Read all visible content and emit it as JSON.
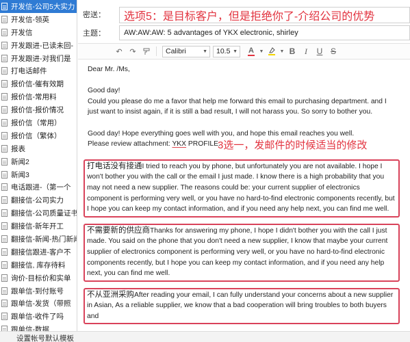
{
  "sidebar": {
    "items": [
      {
        "label": "开发信-公司5大实力",
        "selected": true
      },
      {
        "label": "开发信-领英"
      },
      {
        "label": "开发信"
      },
      {
        "label": "开发跟进-已读未回-"
      },
      {
        "label": "开发跟进-对我们是"
      },
      {
        "label": "打电话邮件"
      },
      {
        "label": "报价信-催有效期"
      },
      {
        "label": "报价信-常用料"
      },
      {
        "label": "报价信-报价情况"
      },
      {
        "label": "报价信（常用）"
      },
      {
        "label": "报价信（繁体）"
      },
      {
        "label": "报表"
      },
      {
        "label": "新闻2"
      },
      {
        "label": "新闻3"
      },
      {
        "label": "电话跟进-（第一个"
      },
      {
        "label": "翻接信-公司实力"
      },
      {
        "label": "翻接信-公司质量证书"
      },
      {
        "label": "翻接信-新年开工"
      },
      {
        "label": "翻接信-新闻-热门新闻"
      },
      {
        "label": "翻接信跟进-客户不"
      },
      {
        "label": "翻接信, 库存待料"
      },
      {
        "label": "询价-目标价和实单"
      },
      {
        "label": "跟单信-到付账号"
      },
      {
        "label": "跟单信-发货（带照"
      },
      {
        "label": "跟单信-收件了吗"
      },
      {
        "label": "跟单信-数据"
      }
    ]
  },
  "header": {
    "cc_label": "密送：",
    "cc_value": "选项5：是目标客户，但是拒绝你了-介绍公司的优势",
    "subject_label": "主题：",
    "subject_value": "AW:AW:AW: 5 advantages of YKX electronic, shirley"
  },
  "toolbar": {
    "font_family": "Calibri",
    "font_size": "10.5",
    "font_color": "#e2333f",
    "highlight_color": "#f3d400"
  },
  "email": {
    "greeting": "Dear  Mr. /Ms,",
    "good_day": "Good day!",
    "para1": "Could you please do me a favor that help me forward this email to purchasing department. and I just want to insist again, if it is still a bad result, I will not harass you. So sorry to bother you.",
    "para2_line1": "Good day! Hope everything goes well with you, and hope this email reaches you well.",
    "para2_line2_prefix": "Please review attachment: ",
    "para2_line2_link": "YKX",
    "para2_line2_suffix": " PROFILE.",
    "annotation": "3选一，发邮件的时候适当的修改",
    "option1_cn": "打电话没有接通",
    "option1_en": "I tried to reach you by phone, but unfortunately you are not available. I hope I won't bother you with the call or the email I just made. I know there is a high probability that you may not need a new supplier. The reasons could be: your current supplier of electronics component is performing very well, or you have no hard-to-find electronic components recently, but I hope you can keep my contact information, and if you need any help next, you can find me well.",
    "option2_cn": "不需要新的供应商",
    "option2_en": "Thanks for answering my phone, I hope I didn't bother you with the call I just made. You said on the phone that you don't need a new supplier, I know that maybe your current supplier of electronics component is performing very well, or you have no hard-to-find electronic components recently, but I hope you can keep my contact information, and if you need any help next, you can find me well.",
    "option3_cn": "不从亚洲采购",
    "option3_en": "After reading your email, I can fully understand your concerns about a new supplier in Asian, As a reliable supplier, we know that a bad cooperation will bring troubles to both buyers and"
  },
  "footer": {
    "label": "设置帐号默认模板"
  }
}
